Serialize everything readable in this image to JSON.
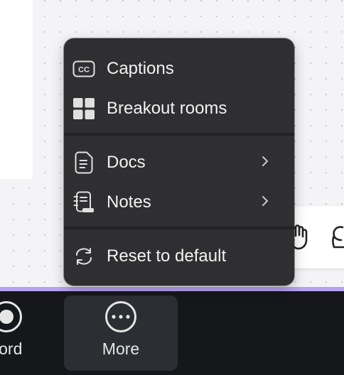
{
  "menu": {
    "items": [
      {
        "label": "Captions",
        "icon": "closed-captions-icon",
        "has_submenu": false
      },
      {
        "label": "Breakout rooms",
        "icon": "grid-icon",
        "has_submenu": false
      },
      {
        "label": "Docs",
        "icon": "document-icon",
        "has_submenu": true
      },
      {
        "label": "Notes",
        "icon": "notebook-icon",
        "has_submenu": true
      },
      {
        "label": "Reset to default",
        "icon": "reset-icon",
        "has_submenu": false
      }
    ],
    "captions_icon_text": "CC"
  },
  "bottom_bar": {
    "record_label": "cord",
    "more_label": "More"
  },
  "colors": {
    "menu_bg": "#2f2f31",
    "bar_bg": "#15171a",
    "accent_line": "#b8a3f2",
    "more_button_bg": "#2c2e33"
  }
}
